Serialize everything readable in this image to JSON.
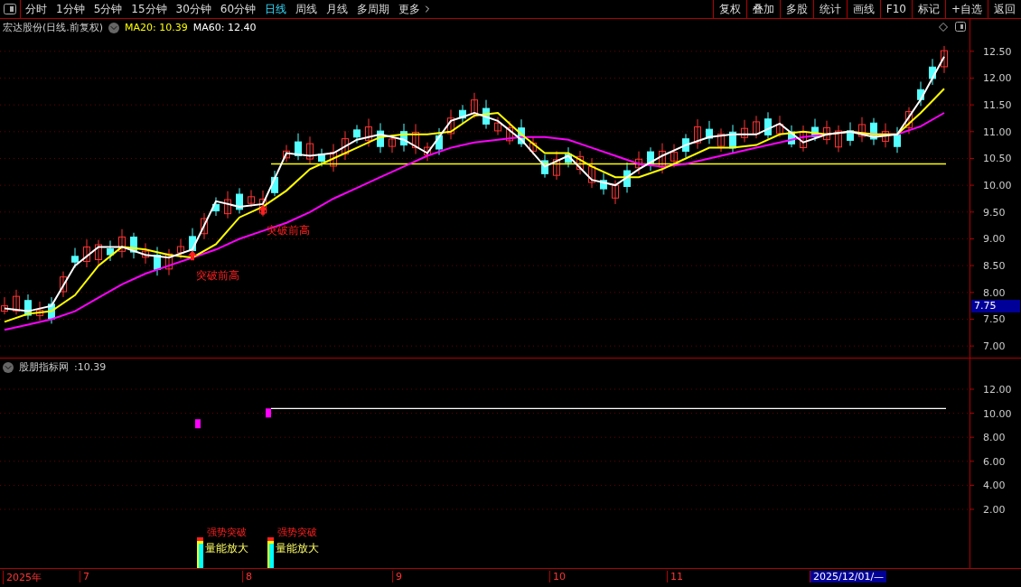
{
  "toolbar": {
    "periods": [
      {
        "label": "分时",
        "selected": false
      },
      {
        "label": "1分钟",
        "selected": false
      },
      {
        "label": "5分钟",
        "selected": false
      },
      {
        "label": "15分钟",
        "selected": false
      },
      {
        "label": "30分钟",
        "selected": false
      },
      {
        "label": "60分钟",
        "selected": false
      },
      {
        "label": "日线",
        "selected": true
      },
      {
        "label": "周线",
        "selected": false
      },
      {
        "label": "月线",
        "selected": false
      },
      {
        "label": "多周期",
        "selected": false
      },
      {
        "label": "更多",
        "selected": false
      }
    ],
    "actions": [
      "复权",
      "叠加",
      "多股",
      "统计",
      "画线",
      "F10",
      "标记",
      "+自选",
      "返回"
    ]
  },
  "main_chart": {
    "title": "宏达股份(日线.前复权)",
    "legend": [
      {
        "label": "MA20: 10.39",
        "color": "#ffff00"
      },
      {
        "label": "MA60: 12.40",
        "color": "#ffffff"
      }
    ],
    "price_tag": "7.75",
    "axis_labels": [
      "12.50",
      "12.00",
      "11.50",
      "11.00",
      "10.50",
      "10.00",
      "9.50",
      "9.00",
      "8.50",
      "8.00",
      "7.50",
      "7.00"
    ],
    "signals": [
      "突破前高",
      "突破前高"
    ]
  },
  "indicator": {
    "name": "股朋指标网",
    "value": ":10.39",
    "axis_labels": [
      "12.00",
      "10.00",
      "8.00",
      "6.00",
      "4.00",
      "2.00"
    ],
    "signals": [
      {
        "upper": "强势突破",
        "lower": "量能放大"
      },
      {
        "upper": "强势突破",
        "lower": "量能放大"
      }
    ]
  },
  "date_axis": [
    {
      "label": "2025年",
      "kind": "tick"
    },
    {
      "label": "7",
      "kind": "tick"
    },
    {
      "label": "8",
      "kind": "tick"
    },
    {
      "label": "9",
      "kind": "tick"
    },
    {
      "label": "10",
      "kind": "tick"
    },
    {
      "label": "11",
      "kind": "tick"
    },
    {
      "label": "2025/12/01/—",
      "kind": "cursor"
    }
  ]
}
